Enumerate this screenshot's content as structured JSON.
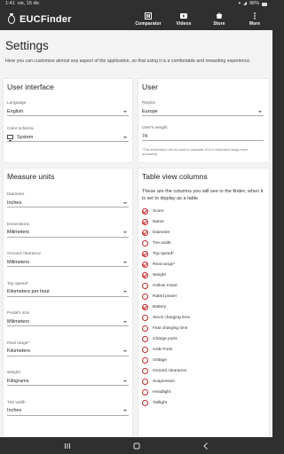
{
  "statusbar": {
    "time": "1:41",
    "date": "vie, 15 dic",
    "battery": "96%"
  },
  "appbar": {
    "logo_text": "EUCFinder",
    "nav": [
      {
        "label": "Comparator",
        "icon": "comparator-icon"
      },
      {
        "label": "Videos",
        "icon": "video-icon"
      },
      {
        "label": "Store",
        "icon": "store-icon"
      },
      {
        "label": "More",
        "icon": "more-vert-icon"
      }
    ]
  },
  "page": {
    "title": "Settings",
    "intro": "Here you can customize almost any aspect of the application, so that using it is a comfortable and rewarding experience."
  },
  "user_interface": {
    "title": "User interface",
    "language_label": "Language",
    "language_value": "English",
    "color_scheme_label": "Color schema",
    "color_scheme_value": "System"
  },
  "user": {
    "title": "User",
    "region_label": "Region",
    "region_value": "Europe",
    "weight_label": "User's weight",
    "weight_value": "74",
    "weight_help": "*This information will be used to calculate EUCs' estimated range more accurately"
  },
  "measure_units": {
    "title": "Measure units",
    "fields": [
      {
        "label": "Diameter",
        "value": "Inches"
      },
      {
        "label": "Dimensions",
        "value": "Milimeters"
      },
      {
        "label": "Ground clearance",
        "value": "Milimeters"
      },
      {
        "label": "Top speed*",
        "value": "Kilometers per hour"
      },
      {
        "label": "Pedal's size",
        "value": "Milimeters"
      },
      {
        "label": "Real range*",
        "value": "Kilometers"
      },
      {
        "label": "Weight",
        "value": "Kilograms"
      },
      {
        "label": "Tire width",
        "value": "Inches"
      }
    ]
  },
  "table_columns": {
    "title": "Table view columns",
    "description": "These are the columns you will see in the finder, when it is set to display as a table",
    "items": [
      {
        "label": "Score",
        "checked": true
      },
      {
        "label": "Name",
        "checked": true
      },
      {
        "label": "Diameter",
        "checked": true
      },
      {
        "label": "Tire width",
        "checked": false
      },
      {
        "label": "Top speed*",
        "checked": true
      },
      {
        "label": "Real range*",
        "checked": true
      },
      {
        "label": "Weight",
        "checked": true
      },
      {
        "label": "Hollow motor",
        "checked": false
      },
      {
        "label": "Rated power",
        "checked": false
      },
      {
        "label": "Battery",
        "checked": true
      },
      {
        "label": "Stock charging time",
        "checked": false
      },
      {
        "label": "Fast charging time",
        "checked": false
      },
      {
        "label": "Charge ports",
        "checked": false
      },
      {
        "label": "USB Ports",
        "checked": false
      },
      {
        "label": "Voltage",
        "checked": false
      },
      {
        "label": "Ground clearance",
        "checked": false
      },
      {
        "label": "Suspension",
        "checked": false
      },
      {
        "label": "Headlight",
        "checked": false
      },
      {
        "label": "Taillight",
        "checked": false
      }
    ]
  },
  "colors": {
    "accent": "#c62828",
    "appbar": "#2f2f2f",
    "background": "#f3f3f3"
  }
}
